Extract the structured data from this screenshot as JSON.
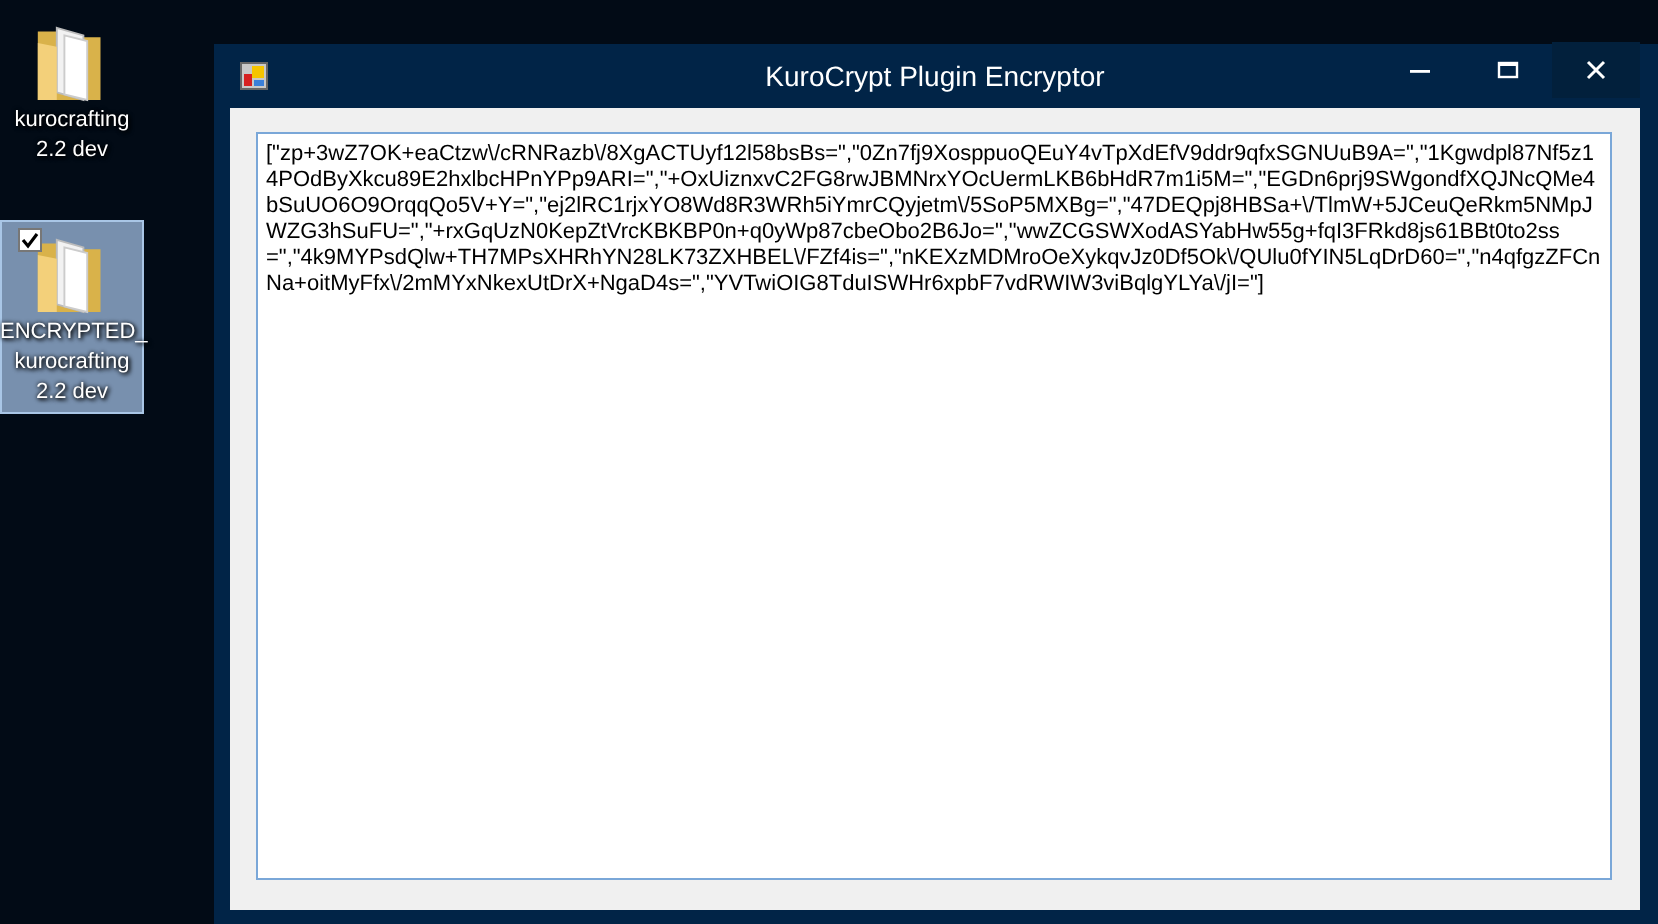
{
  "desktop_icons": [
    {
      "label": "kurocrafting 2.2 dev",
      "selected": false,
      "checked": false
    },
    {
      "label": "ENCRYPTED_ kurocrafting 2.2 dev",
      "selected": true,
      "checked": true
    }
  ],
  "window": {
    "title": "KuroCrypt Plugin Encryptor"
  },
  "textbox": {
    "value": "[\"zp+3wZ7OK+eaCtzw\\/cRNRazb\\/8XgACTUyf12l58bsBs=\",\"0Zn7fj9XosppuoQEuY4vTpXdEfV9ddr9qfxSGNUuB9A=\",\"1Kgwdpl87Nf5z14POdByXkcu89E2hxlbcHPnYPp9ARI=\",\"+OxUiznxvC2FG8rwJBMNrxYOcUermLKB6bHdR7m1i5M=\",\"EGDn6prj9SWgondfXQJNcQMe4bSuUO6O9OrqqQo5V+Y=\",\"ej2lRC1rjxYO8Wd8R3WRh5iYmrCQyjetm\\/5SoP5MXBg=\",\"47DEQpj8HBSa+\\/TlmW+5JCeuQeRkm5NMpJWZG3hSuFU=\",\"+rxGqUzN0KepZtVrcKBKBP0n+q0yWp87cbeObo2B6Jo=\",\"wwZCGSWXodASYabHw55g+fqI3FRkd8js61BBt0to2ss=\",\"4k9MYPsdQlw+TH7MPsXHRhYN28LK73ZXHBEL\\/FZf4is=\",\"nKEXzMDMroOeXykqvJz0Df5Ok\\/QUlu0fYIN5LqDrD60=\",\"n4qfgzZFCnNa+oitMyFfx\\/2mMYxNkexUtDrX+NgaD4s=\",\"YVTwiOIG8TduISWHr6xpbF7vdRWIW3viBqlgYLYa\\/jI=\"]"
  }
}
